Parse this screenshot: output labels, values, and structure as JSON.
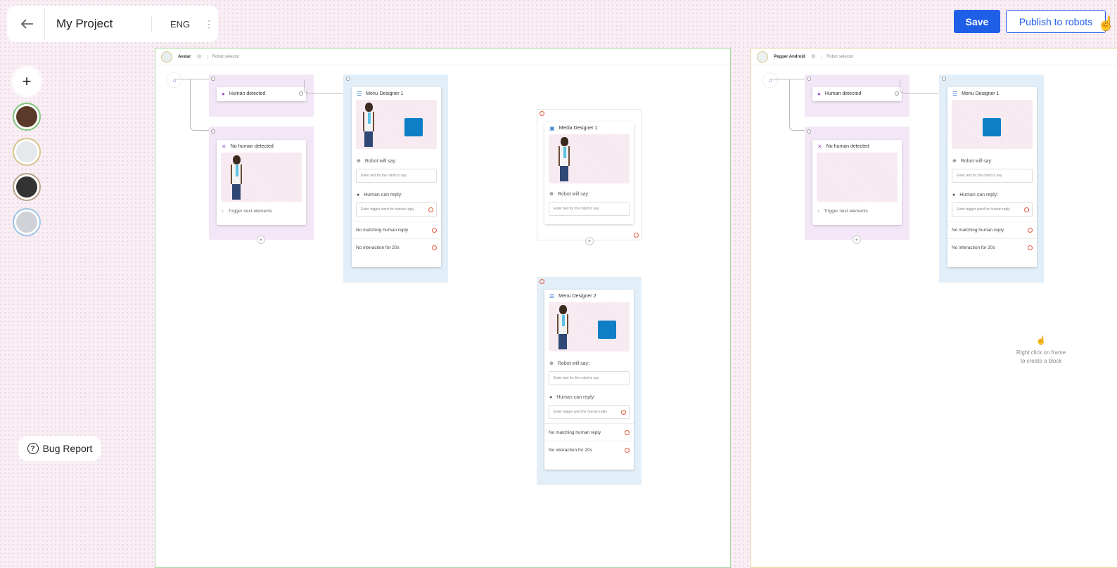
{
  "header": {
    "title": "My Project",
    "language": "ENG"
  },
  "actions": {
    "save": "Save",
    "publish": "Publish to robots"
  },
  "sidebar": {
    "add": "+",
    "bug_report": "Bug Report"
  },
  "frames": {
    "left": {
      "robot_name": "Avatar",
      "selector": "Robot selector"
    },
    "right": {
      "robot_name": "Pepper Android",
      "selector": "Robot selector"
    }
  },
  "blocks": {
    "human_detected": "Human detected",
    "no_human_detected": "No human detected",
    "trigger_next": "Trigger next elements",
    "menu1": "Menu Designer 1",
    "menu2": "Menu Designer 2",
    "media1": "Media Designer 1",
    "robot_will_say": "Robot will say:",
    "robot_placeholder": "Enter text for the robot to say",
    "human_can_reply": "Human can reply:",
    "human_placeholder": "Enter trigger word for human reply",
    "no_matching": "No matching human reply",
    "no_interaction": "No interaction for 20s"
  },
  "hint": {
    "line1": "Right click on frame",
    "line2": "to create a block"
  },
  "colors": {
    "accent": "#1f5fe8",
    "brand_blue": "#0e7ec6",
    "warning_ring": "#e2553a"
  }
}
